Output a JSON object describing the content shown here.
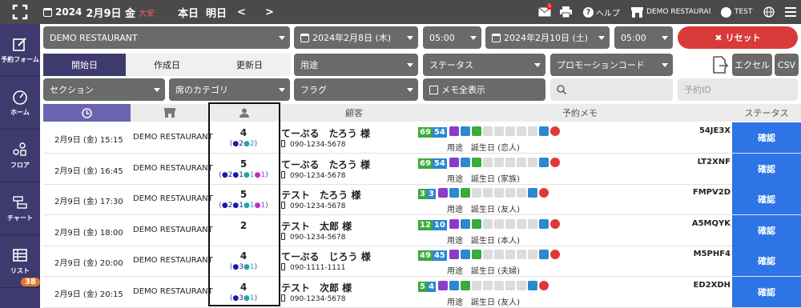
{
  "topbar": {
    "year": "2024",
    "date": "2月9日 金",
    "rokuyo": "大安",
    "today": "本日",
    "tomorrow": "明日",
    "prev": "<",
    "next": ">",
    "help": "ヘルプ",
    "restaurant": "DEMO RESTAURANT",
    "user": "TEST",
    "mail_badge": "1"
  },
  "sidebar": [
    {
      "label": "予約フォーム"
    },
    {
      "label": "ホーム"
    },
    {
      "label": "フロア"
    },
    {
      "label": "チャート"
    },
    {
      "label": "リスト"
    }
  ],
  "sidebar_badge": "38",
  "filters": {
    "restaurant": "DEMO RESTAURANT",
    "date_from": "2024年2月8日 (木)",
    "time_from": "05:00",
    "date_to": "2024年2月10日 (土)",
    "time_to": "05:00",
    "reset": "リセット",
    "tabs": [
      "開始日",
      "作成日",
      "更新日"
    ],
    "purpose": "用途",
    "status": "ステータス",
    "promo": "プロモーションコード",
    "excel": "エクセル",
    "csv": "CSV",
    "section": "セクション",
    "seat_category": "席のカテゴリ",
    "flag": "フラグ",
    "show_memo": "メモ全表示",
    "search_placeholder": "",
    "reservation_id_placeholder": "予約ID"
  },
  "table": {
    "headers": {
      "customer": "顧客",
      "memo": "予約メモ",
      "status": "ステータス"
    },
    "rows": [
      {
        "datetime": "2月9日 (金) 15:15",
        "restaurant": "DEMO RESTAURANT",
        "count": "4",
        "sub": [
          [
            "m",
            "2"
          ],
          [
            "g",
            "2"
          ]
        ],
        "name": "てーぶる　たろう 様",
        "tel": "090-1234-5678",
        "n1": "69",
        "n2": "54",
        "memo": "用途　誕生日 (恋人)",
        "code": "54JE3X",
        "status": "確認"
      },
      {
        "datetime": "2月9日 (金) 16:45",
        "restaurant": "DEMO RESTAURANT",
        "count": "5",
        "sub": [
          [
            "m",
            "2"
          ],
          [
            "m",
            "1"
          ],
          [
            "g",
            "1"
          ],
          [
            "p",
            "1"
          ]
        ],
        "name": "てーぶる　たろう 様",
        "tel": "090-1234-5678",
        "n1": "69",
        "n2": "54",
        "memo": "用途　誕生日 (家族)",
        "code": "LT2XNF",
        "status": "確認"
      },
      {
        "datetime": "2月9日 (金) 17:30",
        "restaurant": "DEMO RESTAURANT",
        "count": "5",
        "sub": [
          [
            "m",
            "2"
          ],
          [
            "m",
            "1"
          ],
          [
            "g",
            "1"
          ],
          [
            "p",
            "1"
          ]
        ],
        "name": "テスト　たろう 様",
        "tel": "090-1234-5678",
        "n1": "3",
        "n2": "3",
        "memo": "用途　誕生日 (友人)",
        "code": "FMPV2D",
        "status": "確認"
      },
      {
        "datetime": "2月9日 (金) 18:00",
        "restaurant": "DEMO RESTAURANT",
        "count": "2",
        "sub": [],
        "name": "テスト　太郎 様",
        "tel": "090-1234-5678",
        "n1": "12",
        "n2": "10",
        "memo": "用途　誕生日 (本人)",
        "code": "A5MQYK",
        "status": "確認"
      },
      {
        "datetime": "2月9日 (金) 20:00",
        "restaurant": "DEMO RESTAURANT",
        "count": "4",
        "sub": [
          [
            "m",
            "3"
          ],
          [
            "g",
            "1"
          ]
        ],
        "name": "てーぶる　じろう 様",
        "tel": "090-1111-1111",
        "n1": "49",
        "n2": "45",
        "memo": "用途　誕生日 (夫婦)",
        "code": "M5PHF4",
        "status": "確認"
      },
      {
        "datetime": "2月9日 (金) 20:15",
        "restaurant": "DEMO RESTAURANT",
        "count": "4",
        "sub": [
          [
            "m",
            "3"
          ],
          [
            "g",
            "1"
          ]
        ],
        "name": "テスト　次郎 様",
        "tel": "090-1234-5678",
        "n1": "5",
        "n2": "4",
        "memo": "用途　誕生日 (友人)",
        "code": "ED2XDH",
        "status": "確認"
      }
    ]
  }
}
